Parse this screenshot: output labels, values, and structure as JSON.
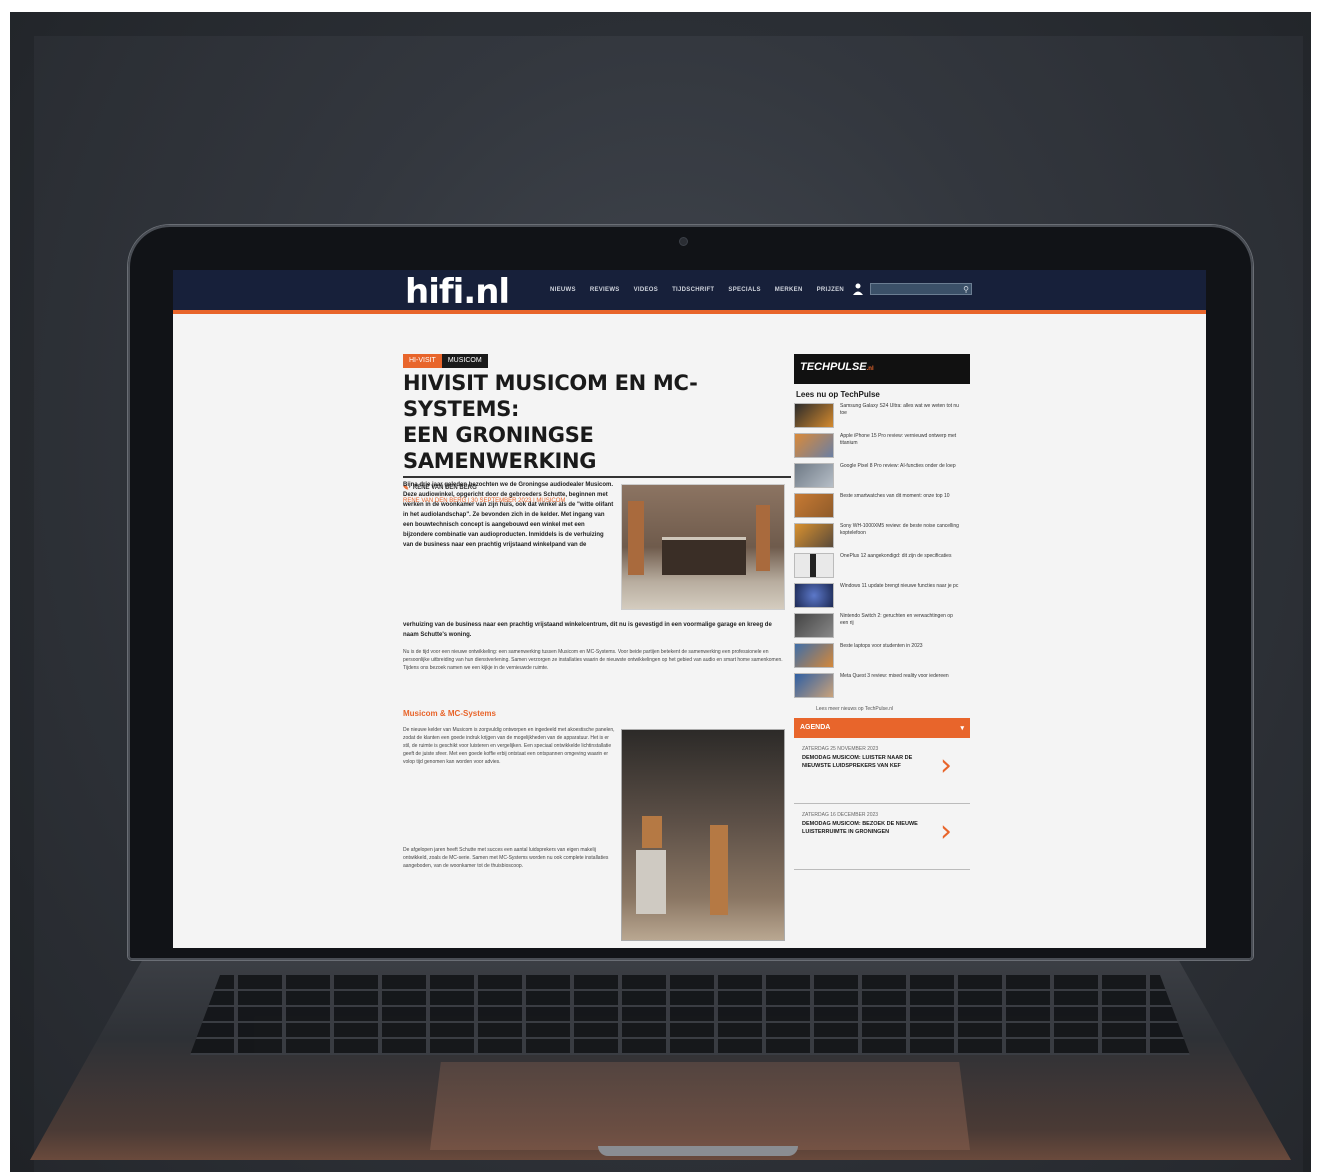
{
  "site": {
    "logo": "hifi.nl",
    "menu": [
      "NIEUWS",
      "REVIEWS",
      "VIDEOS",
      "TIJDSCHRIFT",
      "SPECIALS",
      "MERKEN",
      "PRIJZEN"
    ],
    "search_placeholder": "Zoeken...",
    "accent_color": "#e8652b",
    "nav_color": "#17203a"
  },
  "article": {
    "tags": [
      "HI-VISIT",
      "MUSICOM"
    ],
    "title_line1": "HIVISIT MUSICOM EN MC-SYSTEMS:",
    "title_line2": "EEN GRONINGSE SAMENWERKING",
    "author": "RENE VAN DEN BERG",
    "dateline": "RENE VAN DEN BERG | 30 SEPTEMBER 2023 | MUSICOM",
    "lead": "Bijna drie jaar geleden bezochten we de Groningse audiodealer Musicom. Deze audiowinkel, opgericht door de gebroeders Schutte, beginnen met werken in de woonkamer van zijn huis, ook dat winkel als de \"witte olifant in het audiolandschap\". Ze bevonden zich in de kelder. Met ingang van een bouwtechnisch concept is aangebouwd een winkel met een bijzondere combinatie van audioproducten. Inmiddels is de verhuizing van de business naar een prachtig vrijstaand winkelpand van de",
    "lead2": "verhuizing van de business naar een prachtig vrijstaand winkelcentrum, dit nu is gevestigd in een voormalige garage en kreeg de naam Schutte's woning.",
    "para2": "Nu is de tijd voor een nieuwe ontwikkeling: een samenwerking tussen Musicom en MC-Systems. Voor beide partijen betekent de samenwerking een professionele en persoonlijke uitbreiding van hun dienstverlening. Samen verzorgen ze installaties waarin de nieuwste ontwikkelingen op het gebied van audio en smart home samenkomen. Tijdens ons bezoek namen we een kijkje in de vernieuwde ruimte.",
    "subhead": "Musicom & MC-Systems",
    "para3": "De nieuwe kelder van Musicom is zorgvuldig ontworpen en ingedeeld met akoestische panelen, zodat de klanten een goede indruk krijgen van de mogelijkheden van de apparatuur. Het is er stil, de ruimte is geschikt voor luisteren en vergelijken. Een speciaal ontwikkelde lichtinstallatie geeft de juiste sfeer. Met een goede koffie erbij ontstaat een ontspannen omgeving waarin er volop tijd genomen kan worden voor advies.",
    "para4": "De afgelopen jaren heeft Schutte met succes een aantal luidsprekers van eigen makelij ontwikkeld, zoals de MC-serie. Samen met MC-Systems worden nu ook complete installaties aangeboden, van de woonkamer tot de thuisbioscoop."
  },
  "sidebar": {
    "brand": "TECHPULSE",
    "brand_suffix": ".nl",
    "heading": "Lees nu op TechPulse",
    "items": [
      "Samsung Galaxy S24 Ultra: alles wat we weten tot nu toe",
      "Apple iPhone 15 Pro review: vernieuwd ontwerp met titanium",
      "Google Pixel 8 Pro review: AI-functies onder de loep",
      "Beste smartwatches van dit moment: onze top 10",
      "Sony WH-1000XM5 review: de beste noise cancelling koptelefoon",
      "OnePlus 12 aangekondigd: dit zijn de specificaties",
      "Windows 11 update brengt nieuwe functies naar je pc",
      "Nintendo Switch 2: geruchten en verwachtingen op een rij",
      "Beste laptops voor studenten in 2023",
      "Meta Quest 3 review: mixed reality voor iedereen"
    ],
    "more": "Lees meer nieuws op TechPulse.nl",
    "agenda_label": "AGENDA",
    "agenda": [
      {
        "date": "ZATERDAG 25 NOVEMBER 2023",
        "title": "DEMODAG MUSICOM: LUISTER NAAR DE NIEUWSTE LUIDSPREKERS VAN KEF"
      },
      {
        "date": "ZATERDAG 16 DECEMBER 2023",
        "title": "DEMODAG MUSICOM: BEZOEK DE NIEUWE LUISTERRUIMTE IN GRONINGEN"
      }
    ]
  }
}
